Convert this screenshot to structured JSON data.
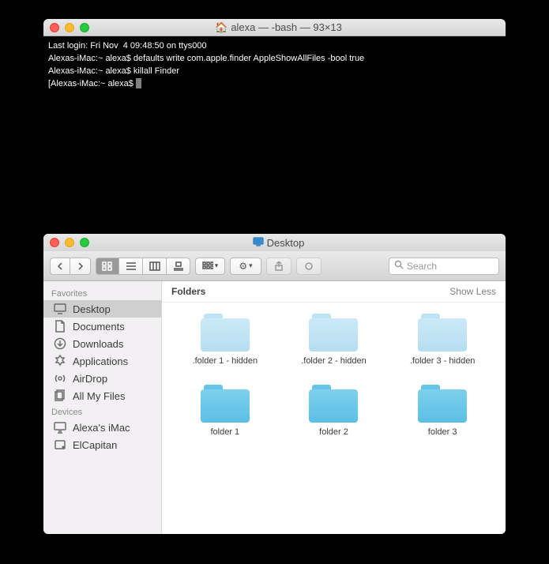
{
  "terminal": {
    "title": "alexa — -bash — 93×13",
    "lines": [
      "Last login: Fri Nov  4 09:48:50 on ttys000",
      "Alexas-iMac:~ alexa$ defaults write com.apple.finder AppleShowAllFiles -bool true",
      "Alexas-iMac:~ alexa$ killall Finder",
      "[Alexas-iMac:~ alexa$ "
    ]
  },
  "finder": {
    "title": "Desktop",
    "search_placeholder": "Search",
    "sidebar": {
      "favorites_label": "Favorites",
      "devices_label": "Devices",
      "favorites": [
        {
          "label": "Desktop",
          "icon": "desktop",
          "selected": true
        },
        {
          "label": "Documents",
          "icon": "documents",
          "selected": false
        },
        {
          "label": "Downloads",
          "icon": "downloads",
          "selected": false
        },
        {
          "label": "Applications",
          "icon": "applications",
          "selected": false
        },
        {
          "label": "AirDrop",
          "icon": "airdrop",
          "selected": false
        },
        {
          "label": "All My Files",
          "icon": "allfiles",
          "selected": false
        }
      ],
      "devices": [
        {
          "label": "Alexa's iMac",
          "icon": "imac"
        },
        {
          "label": "ElCapitan",
          "icon": "disk"
        }
      ]
    },
    "section": {
      "title": "Folders",
      "toggle": "Show Less"
    },
    "folders": [
      {
        "name": ".folder 1 - hidden",
        "hidden": true
      },
      {
        "name": ".folder 2 - hidden",
        "hidden": true
      },
      {
        "name": ".folder 3 - hidden",
        "hidden": true
      },
      {
        "name": "folder 1",
        "hidden": false
      },
      {
        "name": "folder 2",
        "hidden": false
      },
      {
        "name": "folder 3",
        "hidden": false
      }
    ]
  }
}
